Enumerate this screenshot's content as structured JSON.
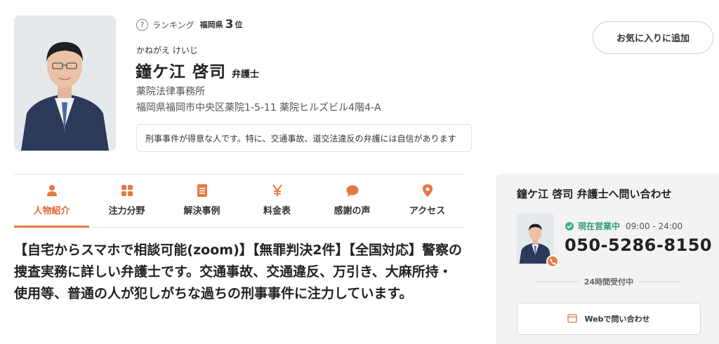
{
  "profile": {
    "ranking_help_icon": "?",
    "ranking_label": "ランキング",
    "ranking_pref": "福岡県",
    "ranking_number": "3",
    "ranking_unit": "位",
    "kana": "かねがえ けいじ",
    "name": "鐘ケ江 啓司",
    "title": "弁護士",
    "office": "薬院法律事務所",
    "address": "福岡県福岡市中央区薬院1-5-11 薬院ヒルズビル4階4-A",
    "tagline": "刑事事件が得意な人です。特に、交通事故、道交法違反の弁護には自信があります"
  },
  "favorite_button": "お気に入りに追加",
  "tabs": [
    {
      "label": "人物紹介",
      "icon": "person-icon",
      "active": true
    },
    {
      "label": "注力分野",
      "icon": "grid-icon",
      "active": false
    },
    {
      "label": "解決事例",
      "icon": "document-icon",
      "active": false
    },
    {
      "label": "料金表",
      "icon": "yen-icon",
      "active": false
    },
    {
      "label": "感謝の声",
      "icon": "speech-bubble-icon",
      "active": false
    },
    {
      "label": "アクセス",
      "icon": "map-pin-icon",
      "active": false
    }
  ],
  "intro": "【自宅からスマホで相談可能(zoom)】【無罪判決2件】【全国対応】警察の捜査実務に詳しい弁護士です。交通事故、交通違反、万引き、大麻所持・使用等、普通の人が犯しがちな過ちの刑事事件に注力しています。",
  "contact": {
    "title": "鐘ケ江 啓司 弁護士へ問い合わせ",
    "status": "現在営業中",
    "hours": "09:00 - 24:00",
    "phone": "050-5286-8150",
    "reception": "24時間受付中",
    "web_button": "Webで問い合わせ"
  },
  "colors": {
    "accent": "#e8773f",
    "status_green": "#2e9d74"
  }
}
